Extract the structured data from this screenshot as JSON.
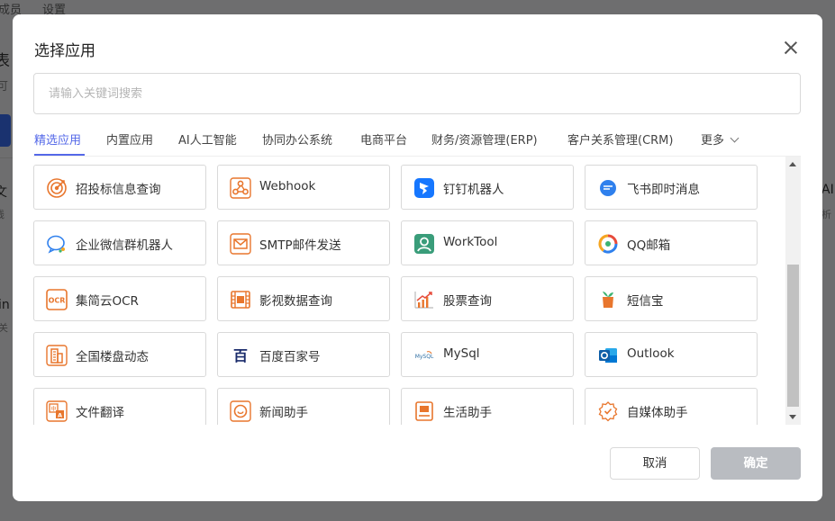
{
  "background": {
    "nav_items": [
      "成员",
      "设置"
    ],
    "fragments": [
      "表",
      "可",
      "文",
      "线",
      "in",
      "关",
      "AI",
      "析"
    ]
  },
  "dialog": {
    "title": "选择应用",
    "search_placeholder": "请输入关键词搜索",
    "tabs": [
      "精选应用",
      "内置应用",
      "AI人工智能",
      "协同办公系统",
      "电商平台",
      "财务/资源管理(ERP)",
      "客户关系管理(CRM)",
      "更多"
    ],
    "active_tab": "精选应用",
    "apps": [
      {
        "label": "招投标信息查询",
        "icon": "target-icon"
      },
      {
        "label": "Webhook",
        "icon": "webhook-icon"
      },
      {
        "label": "钉钉机器人",
        "icon": "dingtalk-icon"
      },
      {
        "label": "飞书即时消息",
        "icon": "feishu-icon"
      },
      {
        "label": "企业微信群机器人",
        "icon": "wecom-icon"
      },
      {
        "label": "SMTP邮件发送",
        "icon": "mail-icon"
      },
      {
        "label": "WorkTool",
        "icon": "worktool-icon"
      },
      {
        "label": "QQ邮箱",
        "icon": "qqmail-icon"
      },
      {
        "label": "集简云OCR",
        "icon": "ocr-icon"
      },
      {
        "label": "影视数据查询",
        "icon": "film-icon"
      },
      {
        "label": "股票查询",
        "icon": "stock-chart-icon"
      },
      {
        "label": "短信宝",
        "icon": "sms-icon"
      },
      {
        "label": "全国楼盘动态",
        "icon": "building-icon"
      },
      {
        "label": "百度百家号",
        "icon": "baijiahao-icon"
      },
      {
        "label": "MySql",
        "icon": "mysql-icon"
      },
      {
        "label": "Outlook",
        "icon": "outlook-icon"
      },
      {
        "label": "文件翻译",
        "icon": "translate-icon"
      },
      {
        "label": "新闻助手",
        "icon": "news-icon"
      },
      {
        "label": "生活助手",
        "icon": "life-icon"
      },
      {
        "label": "自媒体助手",
        "icon": "media-icon"
      }
    ],
    "cancel_label": "取消",
    "ok_label": "确定"
  },
  "colors": {
    "accent": "#5468e8",
    "icon_orange": "#e8762d",
    "ok_disabled": "#b9bcc1"
  }
}
